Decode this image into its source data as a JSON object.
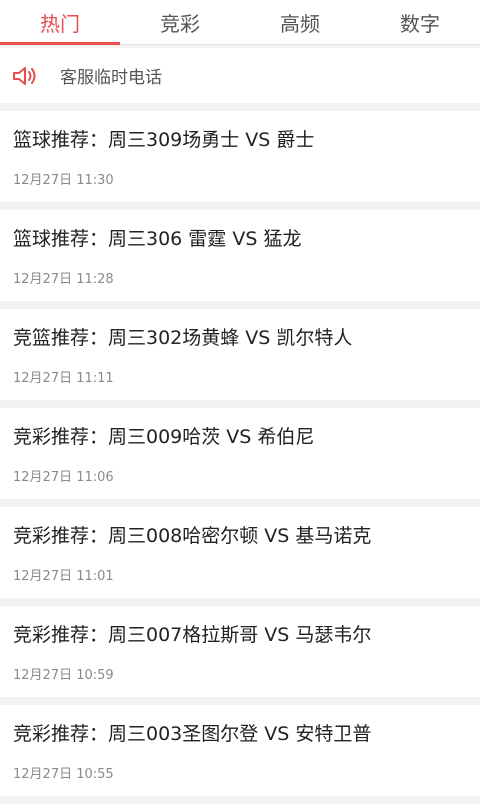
{
  "tabs": [
    {
      "label": "热门",
      "active": true
    },
    {
      "label": "竞彩",
      "active": false
    },
    {
      "label": "高频",
      "active": false
    },
    {
      "label": "数字",
      "active": false
    }
  ],
  "notice": {
    "icon": "speaker-icon",
    "text": "客服临时电话"
  },
  "articles": [
    {
      "title": "篮球推荐：周三309场勇士 VS 爵士",
      "time": "12月27日 11:30"
    },
    {
      "title": "篮球推荐：周三306 雷霆 VS 猛龙",
      "time": "12月27日 11:28"
    },
    {
      "title": "竞篮推荐：周三302场黄蜂 VS 凯尔特人",
      "time": "12月27日 11:11"
    },
    {
      "title": "竞彩推荐：周三009哈茨 VS 希伯尼",
      "time": "12月27日 11:06"
    },
    {
      "title": "竞彩推荐：周三008哈密尔顿 VS 基马诺克",
      "time": "12月27日 11:01"
    },
    {
      "title": "竞彩推荐：周三007格拉斯哥 VS 马瑟韦尔",
      "time": "12月27日 10:59"
    },
    {
      "title": "竞彩推荐：周三003圣图尔登 VS 安特卫普",
      "time": "12月27日 10:55"
    }
  ],
  "colors": {
    "accent": "#e84c4c",
    "background": "#f2f2f2",
    "card": "#ffffff"
  }
}
